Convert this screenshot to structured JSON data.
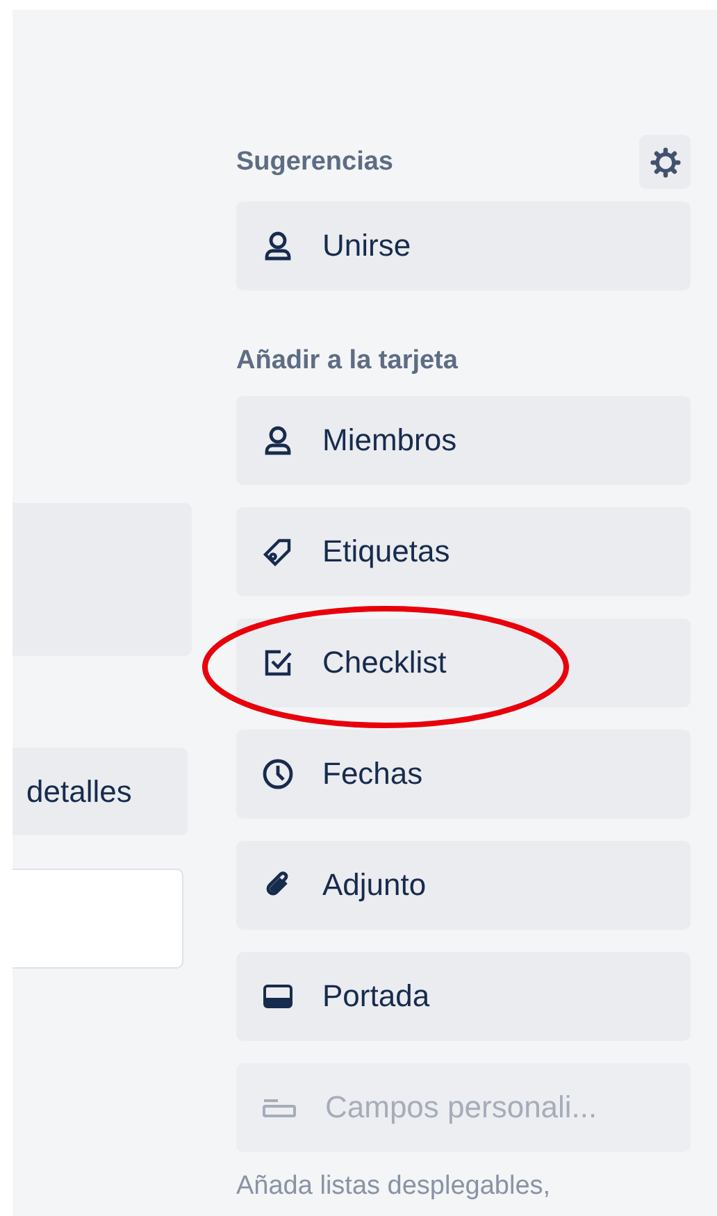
{
  "left_panel": {
    "button": {
      "label": "detalles"
    },
    "field": {
      "kind": "text"
    }
  },
  "suggestions": {
    "title": "Sugerencias",
    "items": [
      {
        "label": "Unirse",
        "disabled": false,
        "highlighted": false
      }
    ]
  },
  "add_to_card": {
    "title": "Añadir a la tarjeta",
    "items": [
      {
        "label": "Miembros",
        "disabled": false,
        "highlighted": false
      },
      {
        "label": "Etiquetas",
        "disabled": false,
        "highlighted": false
      },
      {
        "label": "Checklist",
        "disabled": false,
        "highlighted": true
      },
      {
        "label": "Fechas",
        "disabled": false,
        "highlighted": false
      },
      {
        "label": "Adjunto",
        "disabled": false,
        "highlighted": false
      },
      {
        "label": "Portada",
        "disabled": false,
        "highlighted": false
      },
      {
        "label": "Campos personali...",
        "disabled": true,
        "highlighted": false
      }
    ],
    "note": "Añada listas desplegables,"
  }
}
